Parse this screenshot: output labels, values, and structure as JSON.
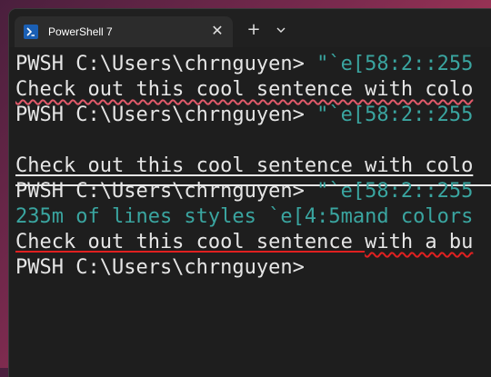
{
  "tab": {
    "title": "PowerShell 7",
    "close_glyph": "✕",
    "new_tab_glyph": "+",
    "icon": "powershell-icon"
  },
  "terminal": {
    "line1_prompt": "PWSH C:\\Users\\chrnguyen> ",
    "line1_cmd": "\"`e[58:2::255",
    "line2": "Check out this cool sentence with colo",
    "line3_prompt": "PWSH C:\\Users\\chrnguyen> ",
    "line3_cmd": "\"`e[58:2::255",
    "line5": "Check out this cool sentence with colo",
    "line6_prompt": "PWSH C:\\Users\\chrnguyen> ",
    "line6_cmd": "\"`e[58:2::255",
    "line7": "235m of lines styles `e[4:5mand colors",
    "line8_a": "Check out this cool sentence ",
    "line8_b": "with a bu",
    "line9_prompt": "PWSH C:\\Users\\chrnguyen>"
  },
  "colors": {
    "background": "#1e1e1e",
    "text": "#e6e6e6",
    "cyan": "#3aa5a0",
    "red_underline": "#e02020",
    "pink_underline": "#e05a6a"
  }
}
